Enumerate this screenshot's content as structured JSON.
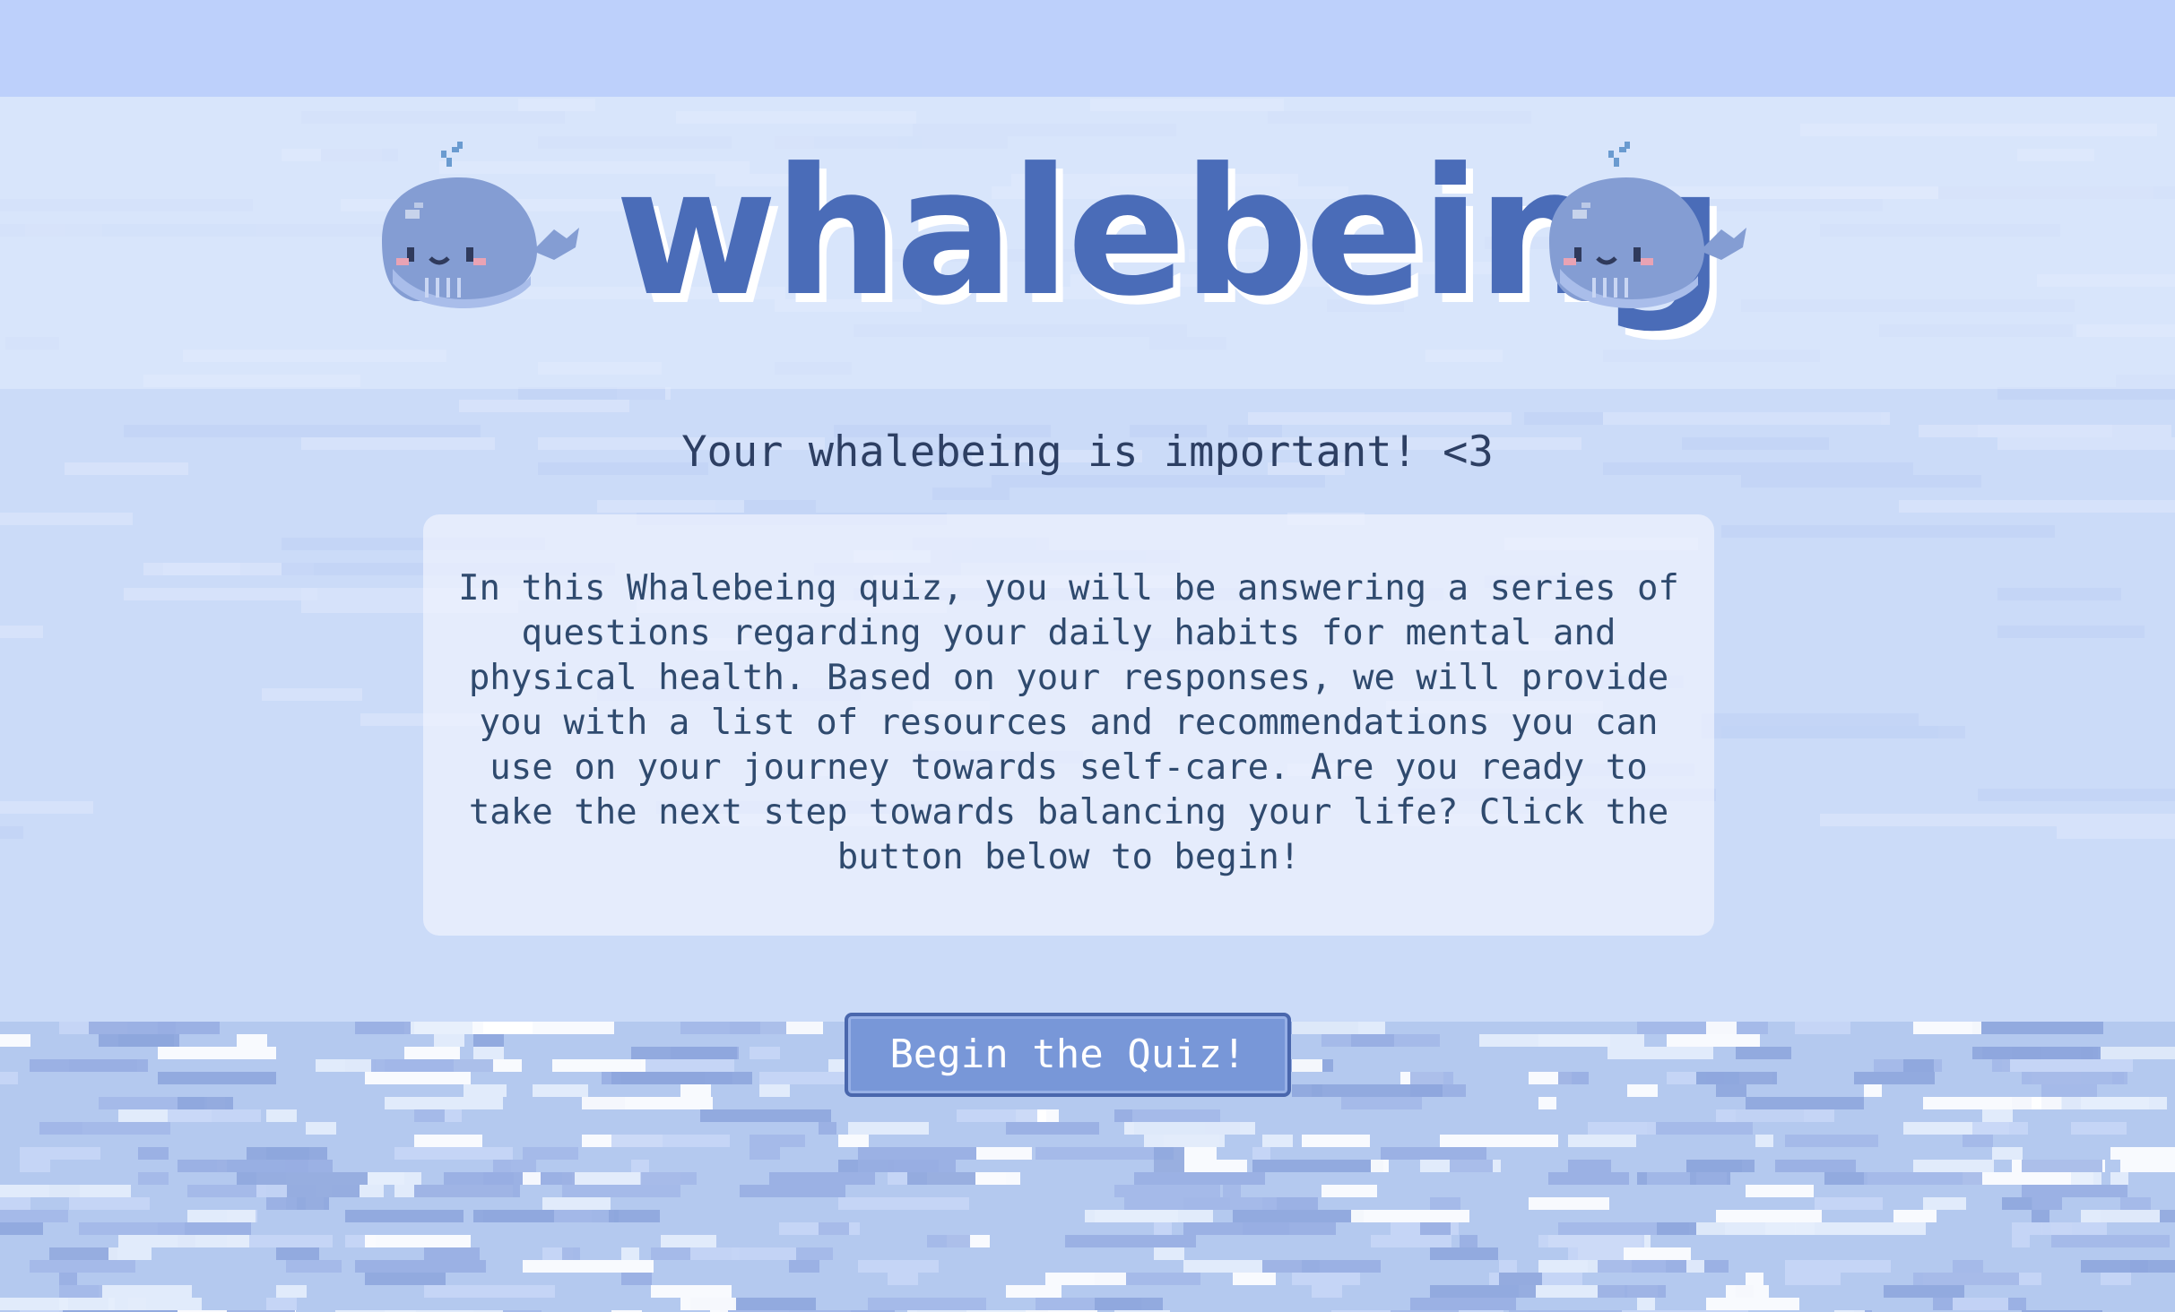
{
  "header": {
    "title": "whalebeing",
    "left_mascot_icon": "whale-icon",
    "right_mascot_icon": "whale-icon"
  },
  "tagline": "Your whalebeing is important! <3",
  "intro": {
    "text": "In this Whalebeing quiz, you will be answering a series of questions regarding your daily habits for mental and physical health. Based on your responses, we will provide you with a list of resources and recommendations you can use on your journey towards self-care. Are you ready to take the next step towards balancing your life? Click the button below to begin!"
  },
  "cta": {
    "label": "Begin the Quiz!"
  },
  "colors": {
    "top_bar": "#bdd0fb",
    "background": "#cbdbf8",
    "title": "#4a6cb8",
    "button_fill": "#7897d8",
    "button_border": "#4a67ad",
    "text": "#2f4a6e"
  }
}
